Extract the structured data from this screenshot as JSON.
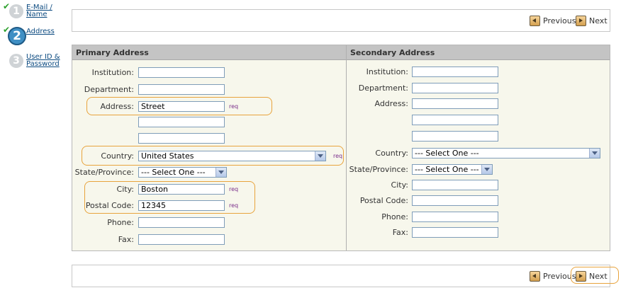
{
  "steps": [
    {
      "number": "1",
      "label": "E-Mail / Name",
      "checked": true,
      "active": false
    },
    {
      "number": "2",
      "label": "Address",
      "checked": true,
      "active": true
    },
    {
      "number": "3",
      "label": "User ID & Password",
      "checked": false,
      "active": false
    }
  ],
  "nav": {
    "previous": "Previous",
    "next": "Next"
  },
  "primary": {
    "title": "Primary Address",
    "institution_label": "Institution:",
    "department_label": "Department:",
    "address_label": "Address:",
    "address_value": "Street",
    "country_label": "Country:",
    "country_value": "United States",
    "state_label": "State/Province:",
    "state_value": "--- Select One ---",
    "city_label": "City:",
    "city_value": "Boston",
    "postal_label": "Postal Code:",
    "postal_value": "12345",
    "phone_label": "Phone:",
    "fax_label": "Fax:",
    "req": "req"
  },
  "secondary": {
    "title": "Secondary Address",
    "institution_label": "Institution:",
    "department_label": "Department:",
    "address_label": "Address:",
    "country_label": "Country:",
    "country_value": "--- Select One ---",
    "state_label": "State/Province:",
    "state_value": "--- Select One ---",
    "city_label": "City:",
    "postal_label": "Postal Code:",
    "phone_label": "Phone:",
    "fax_label": "Fax:"
  },
  "colors": {
    "highlight": "#e8a33c",
    "check": "#2ca02c",
    "active_step": "#3f8fc4"
  }
}
